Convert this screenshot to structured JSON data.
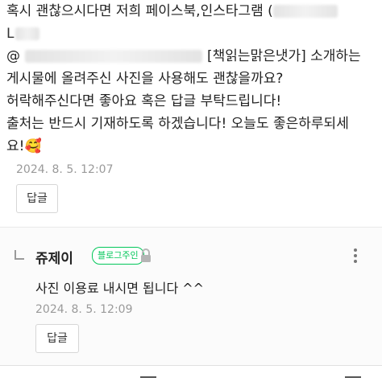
{
  "comment": {
    "line1": "혹시 괜찮으시다면 저희 페이스북,인스타그램 (",
    "line2": "L",
    "line3_prefix": "@",
    "line3_suffix": "[책읽는맑은냇가] 소개하는",
    "line4": "게시물에 올려주신 사진을 사용해도 괜찮을까요?",
    "line5": "허락해주신다면 좋아요 혹은 답글 부탁드립니다!",
    "line6": "출처는 반드시 기재하도록 하겠습니다! 오늘도 좋은하루되세",
    "line7": "요!🥰",
    "date": "2024. 8. 5. 12:07",
    "reply_button": "답글"
  },
  "reply": {
    "author": "쥬제이",
    "badge": "블로그주인",
    "text": "사진 이용료  내시면 됩니다 ^^",
    "date": "2024. 8. 5. 12:09",
    "reply_button": "답글"
  },
  "icons": [
    "reply-arrow-icon",
    "lock-icon",
    "more-options-icon",
    "bottom-menu-icon"
  ]
}
